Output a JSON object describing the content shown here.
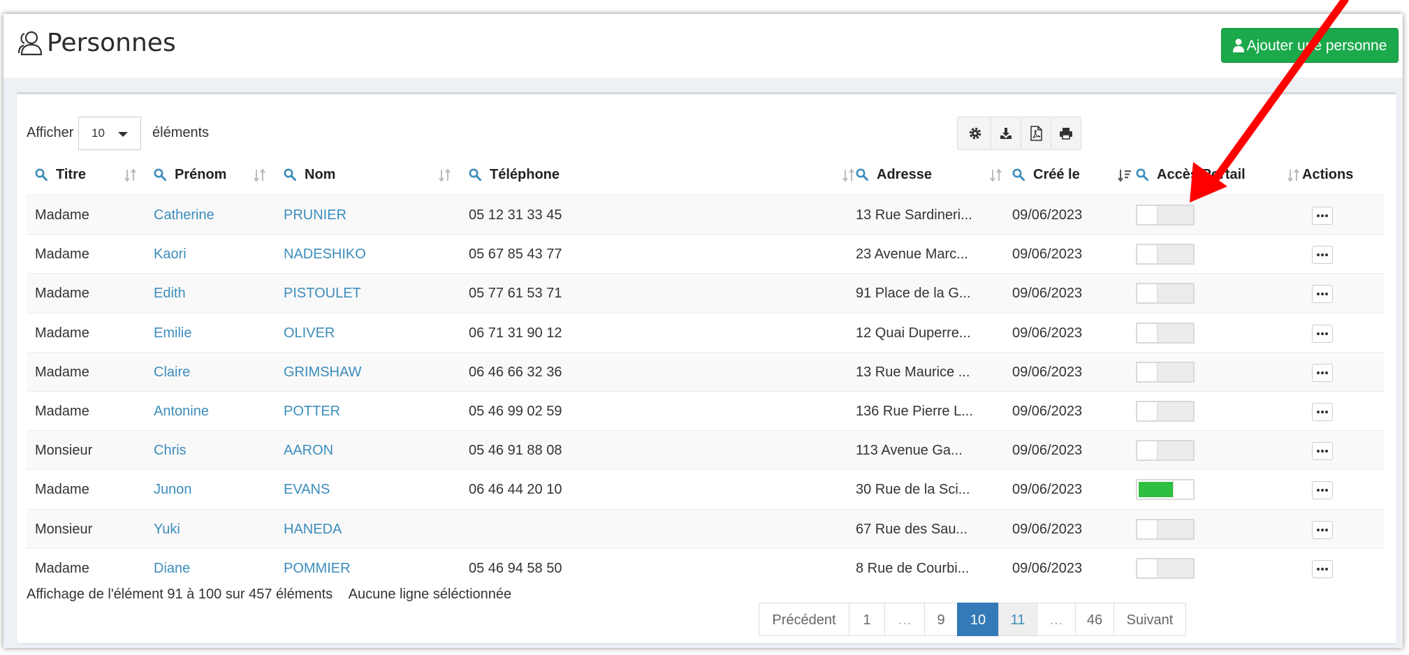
{
  "header": {
    "title": "Personnes",
    "add_button_label": "Ajouter une personne"
  },
  "length_control": {
    "before": "Afficher",
    "selected": "10",
    "after": "éléments"
  },
  "columns": [
    "Titre",
    "Prénom",
    "Nom",
    "Téléphone",
    "Adresse",
    "Créé le",
    "Accès Portail",
    "Actions"
  ],
  "rows": [
    {
      "titre": "Madame",
      "prenom": "Catherine",
      "nom": "PRUNIER",
      "telephone": "05 12 31 33 45",
      "adresse": "13 Rue Sardineri...",
      "cree_le": "09/06/2023",
      "portail": false
    },
    {
      "titre": "Madame",
      "prenom": "Kaori",
      "nom": "NADESHIKO",
      "telephone": "05 67 85 43 77",
      "adresse": "23 Avenue Marc...",
      "cree_le": "09/06/2023",
      "portail": false
    },
    {
      "titre": "Madame",
      "prenom": "Edith",
      "nom": "PISTOULET",
      "telephone": "05 77 61 53 71",
      "adresse": "91 Place de la G...",
      "cree_le": "09/06/2023",
      "portail": false
    },
    {
      "titre": "Madame",
      "prenom": "Emilie",
      "nom": "OLIVER",
      "telephone": "06 71 31 90 12",
      "adresse": "12 Quai Duperre...",
      "cree_le": "09/06/2023",
      "portail": false
    },
    {
      "titre": "Madame",
      "prenom": "Claire",
      "nom": "GRIMSHAW",
      "telephone": "06 46 66 32 36",
      "adresse": "13 Rue Maurice ...",
      "cree_le": "09/06/2023",
      "portail": false
    },
    {
      "titre": "Madame",
      "prenom": "Antonine",
      "nom": "POTTER",
      "telephone": "05 46 99 02 59",
      "adresse": "136 Rue Pierre L...",
      "cree_le": "09/06/2023",
      "portail": false
    },
    {
      "titre": "Monsieur",
      "prenom": "Chris",
      "nom": "AARON",
      "telephone": "05 46 91 88 08",
      "adresse": "113 Avenue Ga...",
      "cree_le": "09/06/2023",
      "portail": false
    },
    {
      "titre": "Madame",
      "prenom": "Junon",
      "nom": "EVANS",
      "telephone": "06 46 44 20 10",
      "adresse": "30 Rue de la Sci...",
      "cree_le": "09/06/2023",
      "portail": true
    },
    {
      "titre": "Monsieur",
      "prenom": "Yuki",
      "nom": "HANEDA",
      "telephone": "",
      "adresse": "67 Rue des Sau...",
      "cree_le": "09/06/2023",
      "portail": false
    },
    {
      "titre": "Madame",
      "prenom": "Diane",
      "nom": "POMMIER",
      "telephone": "05 46 94 58 50",
      "adresse": "8 Rue de Courbi...",
      "cree_le": "09/06/2023",
      "portail": false
    }
  ],
  "footer": {
    "info": "Affichage de l'élément 91 à 100 sur 457 éléments",
    "selection": "Aucune ligne séléctionnée"
  },
  "pagination": {
    "previous": "Précédent",
    "pages": [
      "1",
      "…",
      "9",
      "10",
      "11",
      "…",
      "46"
    ],
    "current": "10",
    "next": "Suivant"
  },
  "colors": {
    "add_button": "#1ba94c",
    "link": "#3c8dbc",
    "page_active": "#337ab7",
    "toggle_on": "#2fbf40",
    "annotation_arrow": "#ff0000"
  }
}
